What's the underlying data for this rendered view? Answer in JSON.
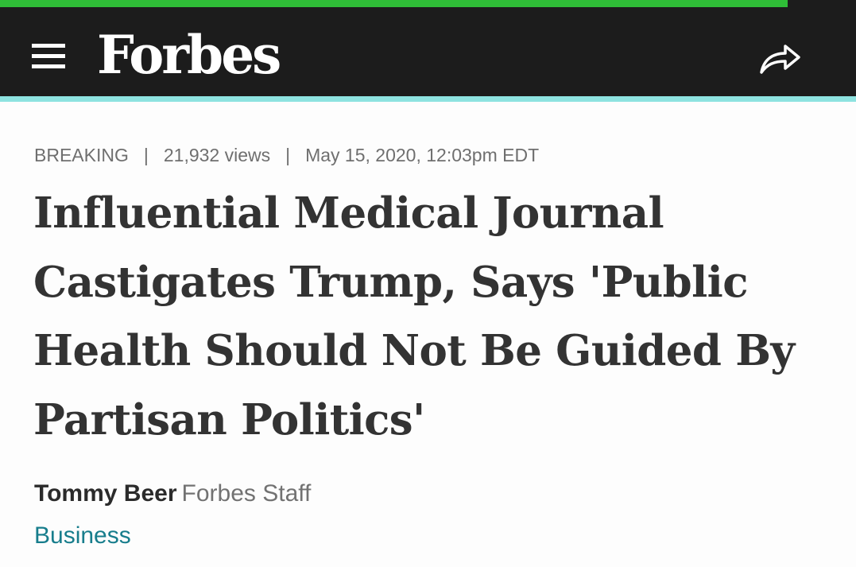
{
  "header": {
    "logo_text": "Forbes",
    "menu_icon": "hamburger-menu-icon",
    "share_icon": "share-arrow-icon",
    "background_color": "#1c1c1c",
    "accent_color": "#8ee3e0"
  },
  "reading_progress": {
    "fraction": 0.92,
    "color": "#2fbd37"
  },
  "article": {
    "meta": {
      "label": "BREAKING",
      "views": "21,932 views",
      "date": "May 15, 2020, 12:03pm EDT",
      "separator": "|"
    },
    "headline": "Influential Medical Journal Castigates Trump, Says 'Public Health Should Not Be Guided By Partisan Politics'",
    "author": "Tommy Beer",
    "author_role": "Forbes Staff",
    "section": "Business"
  }
}
